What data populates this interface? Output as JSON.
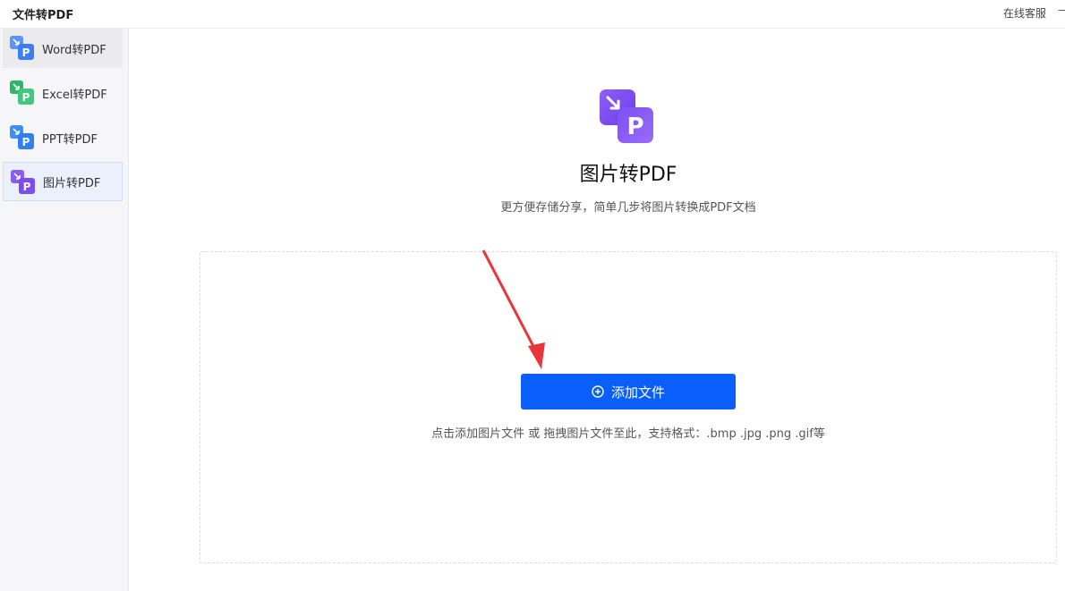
{
  "app": {
    "title": "文件转PDF",
    "support": "在线客服"
  },
  "sidebar": {
    "items": [
      {
        "label": "Word转PDF",
        "icon": "word-to-pdf-icon",
        "color": "#4a8df6",
        "state": "hover"
      },
      {
        "label": "Excel转PDF",
        "icon": "excel-to-pdf-icon",
        "color": "#2fb56a",
        "state": ""
      },
      {
        "label": "PPT转PDF",
        "icon": "ppt-to-pdf-icon",
        "color": "#3d8ef5",
        "state": ""
      },
      {
        "label": "图片转PDF",
        "icon": "image-to-pdf-icon",
        "color": "#7b4cf0",
        "state": "active"
      }
    ]
  },
  "main": {
    "icon": "image-to-pdf-icon",
    "title": "图片转PDF",
    "subtitle": "更方便存储分享，简单几步将图片转换成PDF文档",
    "add_button": "添加文件",
    "hint": "点击添加图片文件 或 拖拽图片文件至此，支持格式：.bmp .jpg .png .gif等"
  },
  "colors": {
    "accent": "#0a5ffb",
    "annotation_arrow": "#e8363a"
  }
}
